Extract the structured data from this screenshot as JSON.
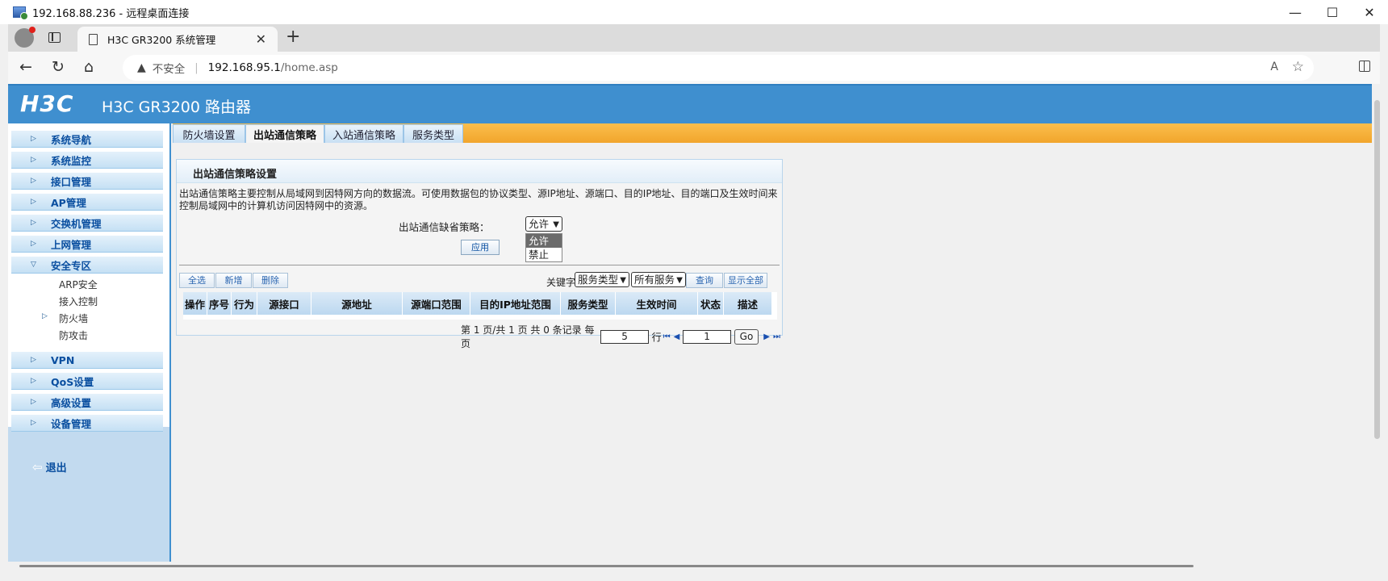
{
  "window": {
    "title": "192.168.88.236 - 远程桌面连接",
    "minimize": "—",
    "maximize": "☐",
    "close": "✕"
  },
  "browser": {
    "tab_title": "H3C GR3200 系统管理",
    "tab_close": "✕",
    "new_tab": "+",
    "insecure_label": "不安全",
    "url_host": "192.168.95.1",
    "url_path": "/home.asp"
  },
  "router": {
    "logo": "H3C",
    "title": "H3C GR3200 路由器",
    "nav": [
      {
        "label": "系统导航"
      },
      {
        "label": "系统监控"
      },
      {
        "label": "接口管理"
      },
      {
        "label": "AP管理"
      },
      {
        "label": "交换机管理"
      },
      {
        "label": "上网管理"
      },
      {
        "label": "安全专区"
      },
      {
        "label": "VPN"
      },
      {
        "label": "QoS设置"
      },
      {
        "label": "高级设置"
      },
      {
        "label": "设备管理"
      }
    ],
    "security_sub": [
      "ARP安全",
      "接入控制",
      "防火墙",
      "防攻击"
    ],
    "logout": "退出"
  },
  "tabs": [
    "防火墙设置",
    "出站通信策略",
    "入站通信策略",
    "服务类型"
  ],
  "active_tab": "出站通信策略",
  "panel": {
    "title": "出站通信策略设置",
    "description": "出站通信策略主要控制从局域网到因特网方向的数据流。可使用数据包的协议类型、源IP地址、源端口、目的IP地址、目的端口及生效时间来控制局域网中的计算机访问因特网中的资源。",
    "default_policy_label": "出站通信缺省策略：",
    "default_policy_value": "允许",
    "policy_options": [
      "允许",
      "禁止"
    ],
    "apply": "应用",
    "select_all": "全选",
    "add": "新增",
    "delete": "删除",
    "keyword_label": "关键字：",
    "keyword_type": "服务类型",
    "keyword_value": "所有服务",
    "query": "查询",
    "show_all": "显示全部",
    "columns": [
      "操作",
      "序号",
      "行为",
      "源接口",
      "源地址",
      "源端口范围",
      "目的IP地址范围",
      "服务类型",
      "生效时间",
      "状态",
      "描述"
    ],
    "pager": {
      "text": "第 1 页/共 1 页 共 0 条记录 每页",
      "per_page": "5",
      "rows_label": "行",
      "page": "1",
      "go": "Go"
    }
  }
}
